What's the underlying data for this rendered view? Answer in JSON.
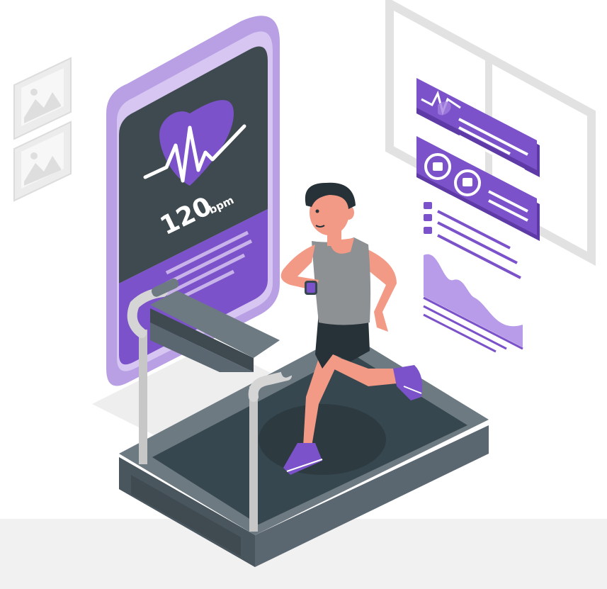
{
  "heart_rate": {
    "value": "120",
    "unit": "bpm"
  },
  "colors": {
    "purple": "#7b52c9",
    "purple_light": "#c8b2ea",
    "purple_pale": "#e3d8f5",
    "screen_dark": "#3e4a4f",
    "machine_dark": "#37474f",
    "machine_mid": "#5a6770",
    "skin": "#f39a86",
    "shirt": "#8d9194"
  },
  "icons": {
    "heart": "heart-pulse-icon",
    "pictures": "picture-frame-icon",
    "watch": "smartwatch-icon"
  }
}
